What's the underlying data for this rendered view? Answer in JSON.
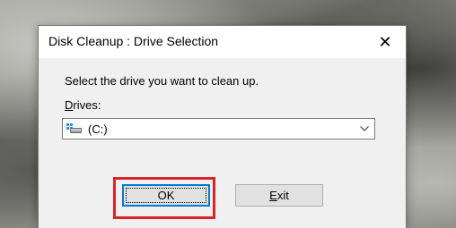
{
  "window": {
    "title": "Disk Cleanup : Drive Selection",
    "close_glyph": "✕"
  },
  "dialog": {
    "prompt": "Select the drive you want to clean up.",
    "drives_label_mnemonic": "D",
    "drives_label_rest": "rives:",
    "drive_select": {
      "value": "(C:)",
      "icon": "windows-drive-icon"
    }
  },
  "buttons": {
    "ok_label": "OK",
    "exit_mnemonic": "E",
    "exit_rest": "xit"
  },
  "colors": {
    "highlight_border": "#d8232a",
    "focus_border": "#0078d7"
  }
}
